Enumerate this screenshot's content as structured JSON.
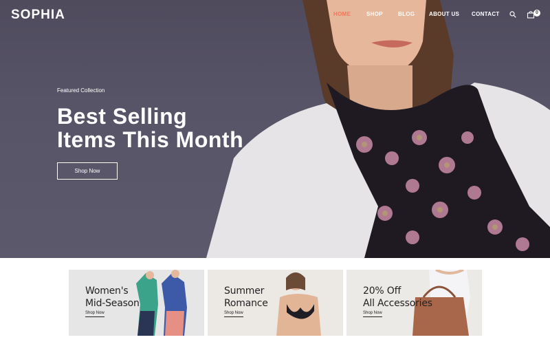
{
  "brand": {
    "logo": "SOPHIA"
  },
  "nav": {
    "items": [
      {
        "label": "HOME",
        "active": true
      },
      {
        "label": "SHOP",
        "active": false
      },
      {
        "label": "BLOG",
        "active": false
      },
      {
        "label": "ABOUT US",
        "active": false
      },
      {
        "label": "CONTACT",
        "active": false
      }
    ],
    "search_icon": "search-icon",
    "cart_icon": "bag-icon",
    "cart_count": "0"
  },
  "hero": {
    "eyebrow": "Featured Collection",
    "title_line1": "Best Selling",
    "title_line2": "Items This Month",
    "cta": "Shop Now"
  },
  "promos": [
    {
      "title_line1": "Women's",
      "title_line2": "Mid-Season",
      "link": "Shop Now"
    },
    {
      "title_line1": "Summer",
      "title_line2": "Romance",
      "link": "Shop Now"
    },
    {
      "title_line1": "20% Off",
      "title_line2": "All Accessories",
      "link": "Shop Now"
    }
  ],
  "colors": {
    "hero_bg": "#585468",
    "accent": "#f2765a",
    "card_bg": "#e9e7e3"
  }
}
